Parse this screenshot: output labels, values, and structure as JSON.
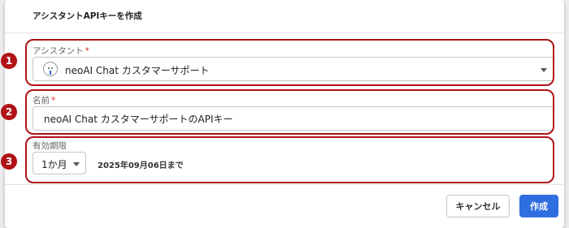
{
  "dialog": {
    "title": "アシスタントAPIキーを作成"
  },
  "assistant_field": {
    "label": "アシスタント",
    "required_mark": "*",
    "selected_value": "neoAI Chat カスタマーサポート"
  },
  "name_field": {
    "label": "名前",
    "required_mark": "*",
    "value": "neoAI Chat カスタマーサポートのAPIキー"
  },
  "expiry_field": {
    "label": "有効期限",
    "selected_period": "1か月",
    "expiry_date_text": "2025年09月06日まで"
  },
  "footer": {
    "cancel_label": "キャンセル",
    "create_label": "作成"
  },
  "annotations": {
    "badges": [
      "1",
      "2",
      "3"
    ],
    "highlight_color": "#b01216"
  },
  "colors": {
    "primary": "#2f6ee0",
    "required": "#d32f2f"
  }
}
